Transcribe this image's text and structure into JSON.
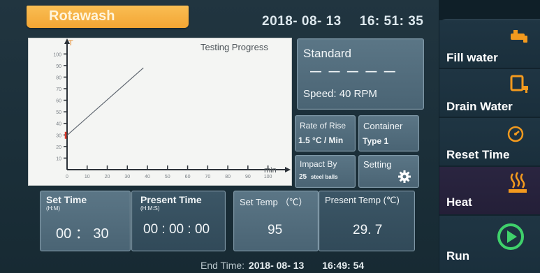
{
  "app": {
    "title": "Rotawash"
  },
  "clock": {
    "date": "2018- 08- 13",
    "time": "16: 51: 35"
  },
  "chart_data": {
    "type": "line",
    "title": "Testing Progress",
    "xlabel": "min",
    "ylabel": "T",
    "x_ticks": [
      "0",
      "10",
      "20",
      "30",
      "40",
      "50",
      "60",
      "70",
      "80",
      "90",
      "100"
    ],
    "y_ticks": [
      "10",
      "20",
      "30",
      "40",
      "50",
      "60",
      "70",
      "80",
      "90",
      "100"
    ],
    "xlim": [
      0,
      105
    ],
    "ylim": [
      0,
      105
    ],
    "grid": false,
    "series": [
      {
        "x": [
          0,
          38
        ],
        "y": [
          29.7,
          88
        ]
      }
    ],
    "current_marker": {
      "y": 29.7
    },
    "colors": {
      "line": "#5f6670",
      "axis": "#2c3238",
      "marker": "#e13a2a"
    }
  },
  "program": {
    "name": "Standard",
    "dashes": "— — — — —",
    "speed": "Speed: 40 RPM"
  },
  "rate_of_rise": {
    "label": "Rate of Rise",
    "value": "1.5 °C / Min"
  },
  "container": {
    "label": "Container",
    "value": "Type 1"
  },
  "impact_by": {
    "label": "Impact By",
    "value_num": "25",
    "value_unit": "steel balls"
  },
  "setting": {
    "label": "Setting",
    "icon": "gear-icon"
  },
  "set_time": {
    "label": "Set Time",
    "unit": "(H:M)",
    "value": "00 ： 30"
  },
  "present_time": {
    "label": "Present Time",
    "unit": "(H:M:S)",
    "value": "00 : 00 : 00"
  },
  "set_temp": {
    "label": "Set Temp （℃）",
    "value": "95"
  },
  "present_temp": {
    "label": "Present Temp (℃)",
    "value": "29. 7"
  },
  "end_time": {
    "label": "End Time:",
    "date": "2018- 08- 13",
    "time": "16:49: 54"
  },
  "sidebar": {
    "fill": {
      "label": "Fill water",
      "icon": "tap-icon"
    },
    "drain": {
      "label": "Drain Water",
      "icon": "drain-icon"
    },
    "reset": {
      "label": "Reset Time",
      "icon": "timer-icon"
    },
    "heat": {
      "label": "Heat",
      "icon": "heat-icon"
    },
    "run": {
      "label": "Run",
      "icon": "play-icon"
    }
  },
  "colors": {
    "accent": "#f3a533",
    "run_green": "#3fd16b",
    "icon_orange": "#f39a1e"
  }
}
